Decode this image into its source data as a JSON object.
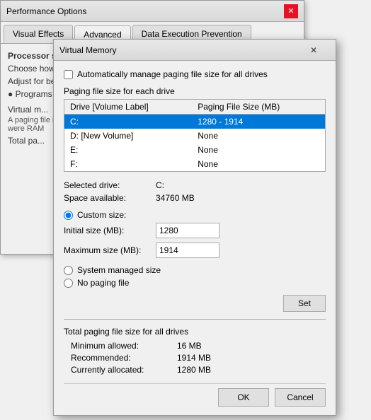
{
  "perfWindow": {
    "title": "Performance Options",
    "tabs": [
      {
        "id": "visual-effects",
        "label": "Visual Effects",
        "active": false
      },
      {
        "id": "advanced",
        "label": "Advanced",
        "active": true
      },
      {
        "id": "dep",
        "label": "Data Execution Prevention",
        "active": false
      }
    ],
    "content": {
      "processor": "Processor scheduling",
      "choose": "Choose how to allocate processor resources.",
      "adjust": "Adjust for best performance of:",
      "prog": "● Programs",
      "virtual": "Virtual m...",
      "apaging": "A paging file is an area on the hard disk that Windows uses as if it",
      "wereRAM": "were RAM",
      "totalpa": "Total pa..."
    }
  },
  "vmDialog": {
    "title": "Virtual Memory",
    "closeSymbol": "✕",
    "autoManageLabel": "Automatically manage paging file size for all drives",
    "autoManageChecked": false,
    "pagingLabel": "Paging file size for each drive",
    "tableHeaders": {
      "drive": "Drive  [Volume Label]",
      "pagingSize": "Paging File Size (MB)"
    },
    "drives": [
      {
        "letter": "C:",
        "label": "",
        "pagingSize": "1280 - 1914",
        "selected": true
      },
      {
        "letter": "D:",
        "label": "[New Volume]",
        "pagingSize": "None",
        "selected": false
      },
      {
        "letter": "E:",
        "label": "",
        "pagingSize": "None",
        "selected": false
      },
      {
        "letter": "F:",
        "label": "",
        "pagingSize": "None",
        "selected": false
      }
    ],
    "selectedDriveLabel": "Selected drive:",
    "selectedDriveValue": "C:",
    "spaceAvailableLabel": "Space available:",
    "spaceAvailableValue": "34760 MB",
    "customSizeLabel": "Custom size:",
    "customSizeChecked": true,
    "initialSizeLabel": "Initial size (MB):",
    "initialSizeValue": "1280",
    "maxSizeLabel": "Maximum size (MB):",
    "maxSizeValue": "1914",
    "systemManagedLabel": "System managed size",
    "noPagingLabel": "No paging file",
    "setButtonLabel": "Set",
    "totalLabel": "Total paging file size for all drives",
    "minimumAllowedLabel": "Minimum allowed:",
    "minimumAllowedValue": "16 MB",
    "recommendedLabel": "Recommended:",
    "recommendedValue": "1914 MB",
    "currentlyAllocatedLabel": "Currently allocated:",
    "currentlyAllocatedValue": "1280 MB",
    "okLabel": "OK",
    "cancelLabel": "Cancel"
  }
}
